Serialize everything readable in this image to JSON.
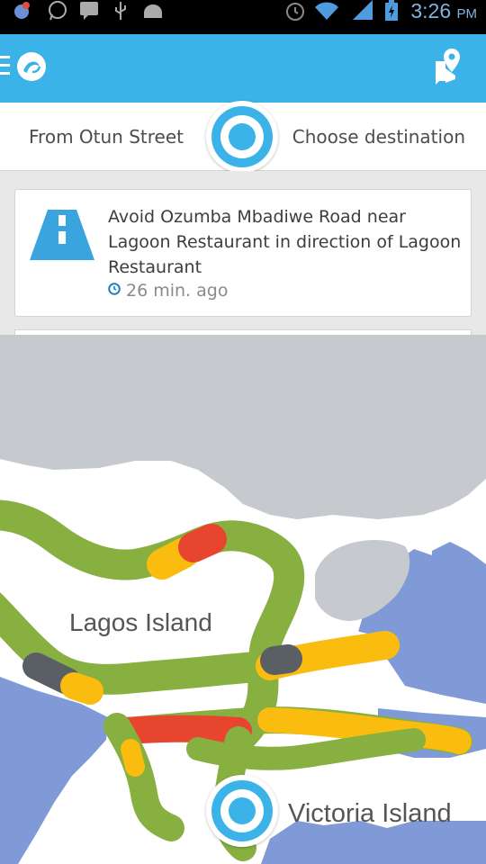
{
  "status_bar": {
    "time": "3:26",
    "ampm": "PM",
    "icons": [
      "notification-icon",
      "whatsapp-icon",
      "message-icon",
      "usb-icon",
      "android-icon",
      "alarm-icon",
      "wifi-icon",
      "signal-icon",
      "battery-icon"
    ]
  },
  "app_bar": {
    "menu_icon": "menu-icon",
    "logo_icon": "app-logo-icon",
    "action_icon": "place-report-icon",
    "color": "#3bb3e8"
  },
  "route": {
    "from": "From Otun Street",
    "destination": "Choose destination"
  },
  "feed": {
    "items": [
      {
        "icon": "road-icon",
        "text": "Avoid Ozumba Mbadiwe Road near Lagoon Restaurant in direction of Lagoon Restaurant",
        "time": "26 min. ago"
      }
    ]
  },
  "map": {
    "labels": {
      "lagos_island": "Lagos Island",
      "victoria_island": "Victoria Island"
    },
    "colors": {
      "water": "#7f9ad6",
      "land": "#c6c9ce",
      "road_free": "#87b040",
      "road_slow": "#f9bc0f",
      "road_jam": "#e8452f",
      "road_closed": "#5a5f66"
    }
  }
}
